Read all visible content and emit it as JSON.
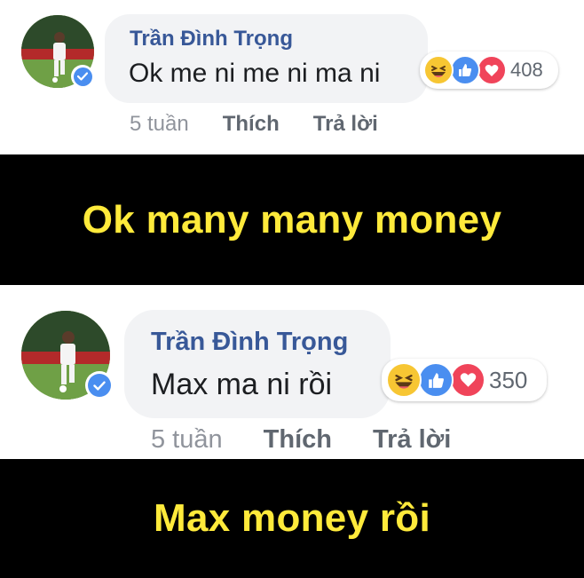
{
  "comments": [
    {
      "author": "Trần Đình Trọng",
      "text": "Ok me ni me ni ma ni",
      "reaction_count": "408",
      "time": "5 tuần",
      "like_label": "Thích",
      "reply_label": "Trả lời",
      "caption": "Ok many many money"
    },
    {
      "author": "Trần Đình Trọng",
      "text": "Max ma ni rồi",
      "reaction_count": "350",
      "time": "5 tuần",
      "like_label": "Thích",
      "reply_label": "Trả lời",
      "caption": "Max money rồi"
    }
  ],
  "icons": {
    "haha": "haha-reaction-icon",
    "like": "like-reaction-icon",
    "love": "love-reaction-icon",
    "verified": "verified-badge-icon"
  },
  "colors": {
    "author": "#385898",
    "bubble": "#f2f3f5",
    "caption_text": "#ffea3b",
    "caption_band": "#000000",
    "like_blue": "#4a8ef0",
    "love_red": "#f0445a",
    "haha_yellow": "#f7c633"
  }
}
